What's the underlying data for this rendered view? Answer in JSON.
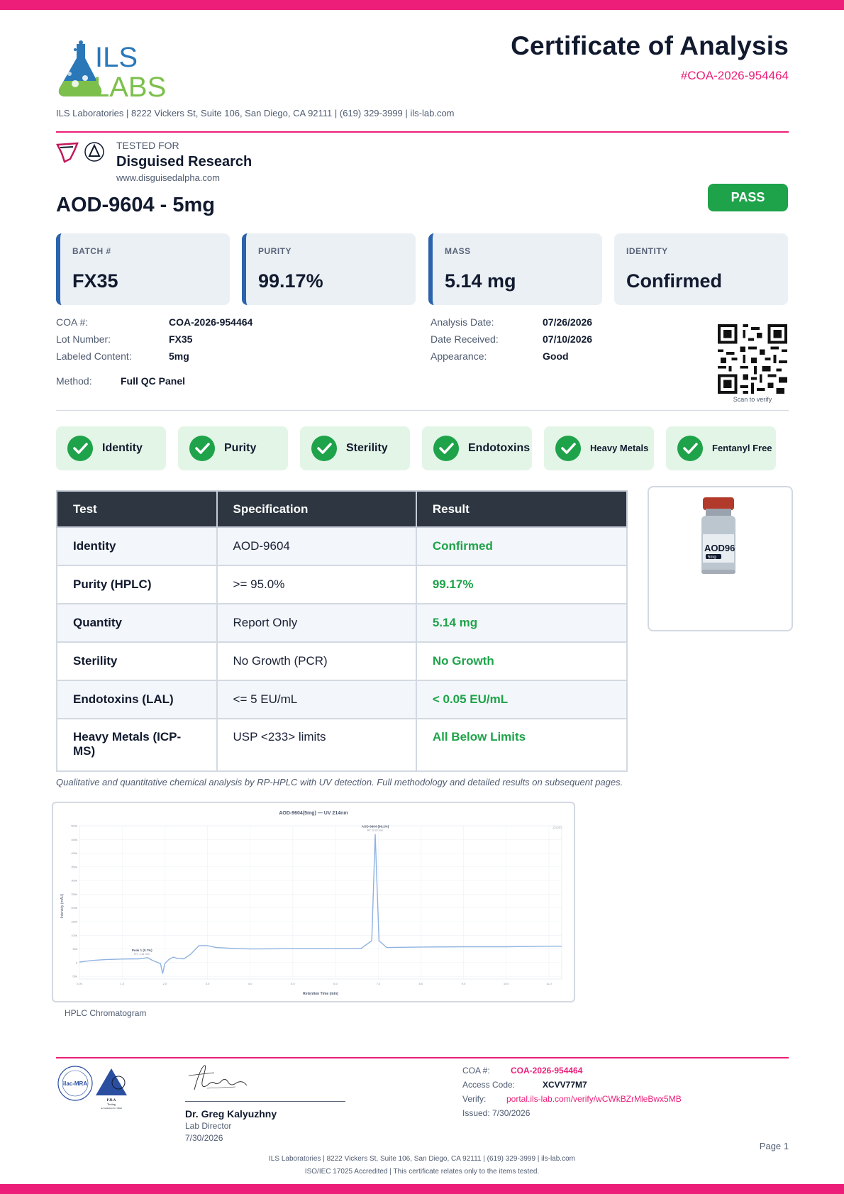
{
  "header": {
    "logo_text": "ILS LABS",
    "title": "Certificate of Analysis",
    "coa_number": "#COA-2026-954464",
    "lab_line": "ILS Laboratories  |  8222 Vickers St, Suite 106, San Diego, CA 92111  |  (619) 329-3999  |  ils-lab.com"
  },
  "client": {
    "tested_for_label": "TESTED FOR",
    "name": "Disguised Research",
    "url": "www.disguisedalpha.com"
  },
  "product": {
    "title": "AOD-9604 - 5mg",
    "status": "PASS"
  },
  "cards": [
    {
      "label": "BATCH #",
      "value": "FX35"
    },
    {
      "label": "PURITY",
      "value": "99.17%"
    },
    {
      "label": "MASS",
      "value": "5.14 mg"
    },
    {
      "label": "IDENTITY",
      "value": "Confirmed"
    }
  ],
  "details": {
    "left": [
      {
        "label": "COA #:",
        "value": "COA-2026-954464"
      },
      {
        "label": "Lot Number:",
        "value": "FX35"
      },
      {
        "label": "Labeled Content:",
        "value": "5mg"
      }
    ],
    "right": [
      {
        "label": "Analysis Date:",
        "value": "07/26/2026"
      },
      {
        "label": "Date Received:",
        "value": "07/10/2026"
      },
      {
        "label": "Appearance:",
        "value": "Good"
      }
    ],
    "method_label": "Method:",
    "method_value": "Full QC Panel",
    "scan_text": "Scan to verify"
  },
  "badges": [
    "Identity",
    "Purity",
    "Sterility",
    "Endotoxins",
    "Heavy Metals",
    "Fentanyl Free"
  ],
  "results_table": {
    "headers": [
      "Test",
      "Specification",
      "Result"
    ],
    "rows": [
      {
        "test": "Identity",
        "spec": "AOD-9604",
        "result": "Confirmed"
      },
      {
        "test": "Purity (HPLC)",
        "spec": ">= 95.0%",
        "result": "99.17%"
      },
      {
        "test": "Quantity",
        "spec": "Report Only",
        "result": "5.14 mg"
      },
      {
        "test": "Sterility",
        "spec": "No Growth (PCR)",
        "result": "No Growth"
      },
      {
        "test": "Endotoxins (LAL)",
        "spec": "<= 5 EU/mL",
        "result": "< 0.05 EU/mL"
      },
      {
        "test": "Heavy Metals (ICP-MS)",
        "spec": "USP <233> limits",
        "result": "All Below Limits"
      }
    ]
  },
  "vial": {
    "label": "AOD96",
    "dose": "5mg"
  },
  "method_note": "Qualitative and quantitative chemical analysis by RP-HPLC with UV detection. Full methodology and detailed results on subsequent pages.",
  "chromatogram": {
    "title": "AOD-9604(5mg) — UV 214nm",
    "xlabel": "Retention Time (min)",
    "ylabel": "Intensity (mAU)",
    "legend": "Zoom",
    "caption": "HPLC Chromatogram",
    "peak_main_label": "AOD-9604 (99.2%)",
    "peak_main_rt": "RT: 6.93 min",
    "peak_minor_label": "Peak 1 (0.7%)",
    "peak_minor_rt": "RT: 1.61 min",
    "y_ticks": [
      "500k",
      "450k",
      "400k",
      "350k",
      "300k",
      "250k",
      "200k",
      "150k",
      "100k",
      "50k",
      "0",
      "-50k"
    ],
    "x_ticks": [
      "0.00",
      "1.0",
      "2.0",
      "3.0",
      "4.0",
      "5.0",
      "6.0",
      "7.0",
      "8.0",
      "9.0",
      "10.0",
      "11.0"
    ],
    "colors": {
      "line": "#8fb3e0",
      "grid": "#eef1f5"
    }
  },
  "chart_data": {
    "type": "line",
    "title": "AOD-9604(5mg) — UV 214nm",
    "xlabel": "Retention Time (min)",
    "ylabel": "Intensity (mAU)",
    "xlim": [
      0,
      11.3
    ],
    "ylim": [
      -60000,
      500000
    ],
    "series": [
      {
        "x": [
          0.0,
          0.3,
          0.6,
          1.0,
          1.4,
          1.6,
          1.7,
          1.9,
          1.95,
          2.0,
          2.1,
          2.2,
          2.3,
          2.45,
          2.6,
          2.8,
          3.0,
          3.2,
          3.6,
          4.0,
          5.0,
          6.0,
          6.6,
          6.85,
          6.93,
          7.02,
          7.2,
          8.0,
          9.0,
          10.0,
          11.0,
          11.3
        ],
        "y": [
          2000,
          8000,
          11000,
          13000,
          14000,
          18000,
          9000,
          -4000,
          -40000,
          -4000,
          12000,
          20000,
          15000,
          14000,
          30000,
          62000,
          62000,
          55000,
          52000,
          50000,
          51000,
          51000,
          52000,
          80000,
          470000,
          80000,
          55000,
          57000,
          58000,
          58000,
          60000,
          60000
        ]
      }
    ]
  },
  "footer": {
    "accred_1": "ilac-MRA",
    "accred_2_line1": "PJLA",
    "accred_2_line2": "Testing",
    "accred_2_line3": "Accreditation No. 59642",
    "signer_name": "Dr. Greg Kalyuzhny",
    "signer_role": "Lab Director",
    "signer_date": "7/30/2026",
    "coa_label": "COA #:",
    "coa_value": "COA-2026-954464",
    "access_label": "Access Code:",
    "access_value": "XCVV77M7",
    "verify_label": "Verify:",
    "verify_value": "portal.ils-lab.com/verify/wCWkBZrMleBwx5MB",
    "issued": "Issued: 7/30/2026",
    "page": "Page 1",
    "line1": "ILS Laboratories  |  8222 Vickers St, Suite 106, San Diego, CA 92111  |  (619) 329-3999  |  ils-lab.com",
    "line2": "ISO/IEC 17025 Accredited  |  This certificate relates only to the items tested."
  },
  "colors": {
    "brand_pink": "#ec1e79",
    "pass_green": "#1ea34a",
    "accent_blue": "#2b63ad",
    "dark_header": "#2d3641"
  }
}
